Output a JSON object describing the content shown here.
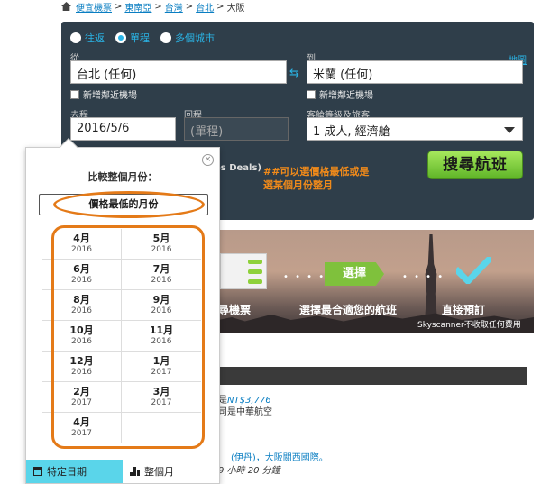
{
  "breadcrumb": [
    "便宜機票",
    "東南亞",
    "台灣",
    "台北",
    "大阪"
  ],
  "search": {
    "trip_types": [
      {
        "label": "往返",
        "selected": false
      },
      {
        "label": "單程",
        "selected": true
      },
      {
        "label": "多個城市",
        "selected": false
      }
    ],
    "from_label": "從",
    "from_value": "台北 (任何)",
    "to_label": "到",
    "to_value": "米蘭 (任何)",
    "map_link": "地圖",
    "nearby_from": "新增鄰近機場",
    "nearby_to": "新增鄰近機場",
    "depart_label": "去程",
    "depart_value": "2016/5/6",
    "return_label": "回程",
    "return_value": "(單程)",
    "cabin_label": "客艙等級及旅客",
    "cabin_value": "1 成人, 經濟艙",
    "search_button": "搜尋航班",
    "deals_fragment": "es Deals)"
  },
  "annotation": [
    "##可以選價格最低或是",
    "選某個月份整月"
  ],
  "hero": {
    "step_button": "選擇",
    "step1_label": "搜尋機票",
    "step2_label": "選擇最合適您的航班",
    "step3_label": "直接預訂",
    "step3_note": "Skyscanner不收取任何費用"
  },
  "results": {
    "line1_prefix": "是",
    "line1_price": "NT$3,776",
    "line2": "司是中華航空",
    "line3": "(伊丹)，大阪關西國際。",
    "line4": "9 小時 20 分鐘"
  },
  "popup": {
    "title": "比較整個月份：",
    "cheapest": "價格最低的月份",
    "months": [
      {
        "month": "4月",
        "year": "2016"
      },
      {
        "month": "5月",
        "year": "2016"
      },
      {
        "month": "6月",
        "year": "2016"
      },
      {
        "month": "7月",
        "year": "2016"
      },
      {
        "month": "8月",
        "year": "2016"
      },
      {
        "month": "9月",
        "year": "2016"
      },
      {
        "month": "10月",
        "year": "2016"
      },
      {
        "month": "11月",
        "year": "2016"
      },
      {
        "month": "12月",
        "year": "2016"
      },
      {
        "month": "1月",
        "year": "2017"
      },
      {
        "month": "2月",
        "year": "2017"
      },
      {
        "month": "3月",
        "year": "2017"
      },
      {
        "month": "4月",
        "year": "2017"
      }
    ],
    "tab_specific": "特定日期",
    "tab_whole_month": "整個月",
    "close_glyph": "×"
  },
  "colors": {
    "accent": "#2ab5e7",
    "panel": "#2f3e4a",
    "annotation": "#e47a18",
    "search_green": "#7fc13c",
    "tab_active": "#5ad5ea"
  }
}
